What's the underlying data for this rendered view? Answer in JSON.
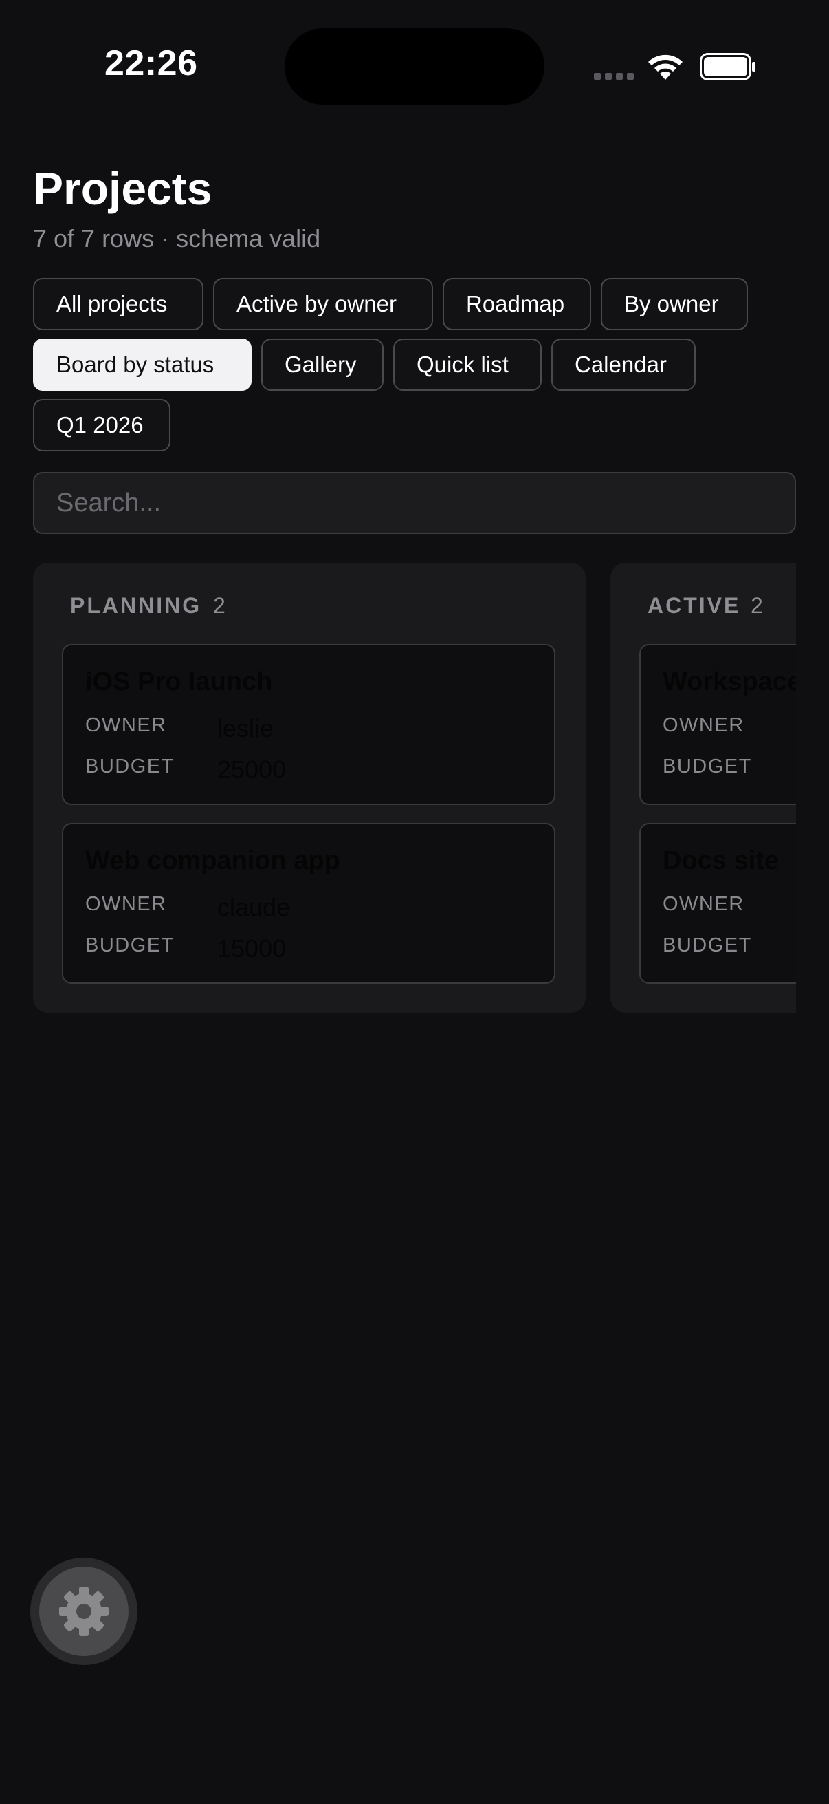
{
  "status_bar": {
    "time": "22:26"
  },
  "header": {
    "title": "Projects",
    "subtitle": "7 of 7 rows · schema valid"
  },
  "views": [
    {
      "label": "All projects",
      "selected": false
    },
    {
      "label": "Active by owner",
      "selected": false
    },
    {
      "label": "Roadmap",
      "selected": false
    },
    {
      "label": "By owner",
      "selected": false
    },
    {
      "label": "Board by status",
      "selected": true
    },
    {
      "label": "Gallery",
      "selected": false
    },
    {
      "label": "Quick list",
      "selected": false
    },
    {
      "label": "Calendar",
      "selected": false
    },
    {
      "label": "Q1 2026",
      "selected": false
    }
  ],
  "search": {
    "placeholder": "Search...",
    "value": ""
  },
  "board": {
    "columns": [
      {
        "name": "PLANNING",
        "count": "2",
        "cards": [
          {
            "title": "iOS Pro launch",
            "owner_label": "OWNER",
            "owner": "leslie",
            "budget_label": "BUDGET",
            "budget": "25000"
          },
          {
            "title": "Web companion app",
            "owner_label": "OWNER",
            "owner": "claude",
            "budget_label": "BUDGET",
            "budget": "15000"
          }
        ]
      },
      {
        "name": "ACTIVE",
        "count": "2",
        "cards": [
          {
            "title": "Workspace",
            "owner_label": "OWNER",
            "budget_label": "BUDGET"
          },
          {
            "title": "Docs site",
            "owner_label": "OWNER",
            "budget_label": "BUDGET"
          }
        ]
      }
    ]
  },
  "fab": {
    "icon": "gear-icon"
  },
  "colors": {
    "background": "#0f0f11",
    "column": "#1a1a1c",
    "chip_selected": "#f2f2f4",
    "muted_text": "#8e8e93"
  }
}
